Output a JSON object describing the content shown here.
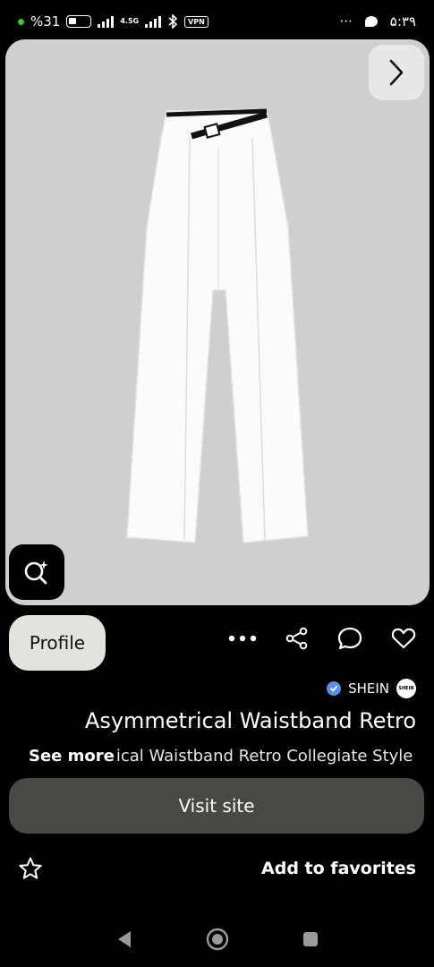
{
  "status_bar": {
    "battery_text": "%31",
    "network_label": "4.5G",
    "vpn_label": "VPN",
    "more_dots": "···",
    "time": "۵:۳۹"
  },
  "pin": {
    "product_image": "white wide-leg trousers with black asymmetrical belt"
  },
  "actions": {
    "profile_label": "Profile"
  },
  "brand": {
    "name": "SHEIN",
    "logo_text": "SHEIN"
  },
  "title": "Asymmetrical Waistband Retro",
  "see_more_label": "See more",
  "description": "ical Waistband Retro Collegiate Style",
  "visit_label": "Visit site",
  "favorites_label": "Add to favorites",
  "colors": {
    "background": "#000000",
    "card_bg": "#d0cfcf",
    "profile_bg": "#e3e3de",
    "visit_bg": "#484845",
    "verified": "#5b8def"
  }
}
